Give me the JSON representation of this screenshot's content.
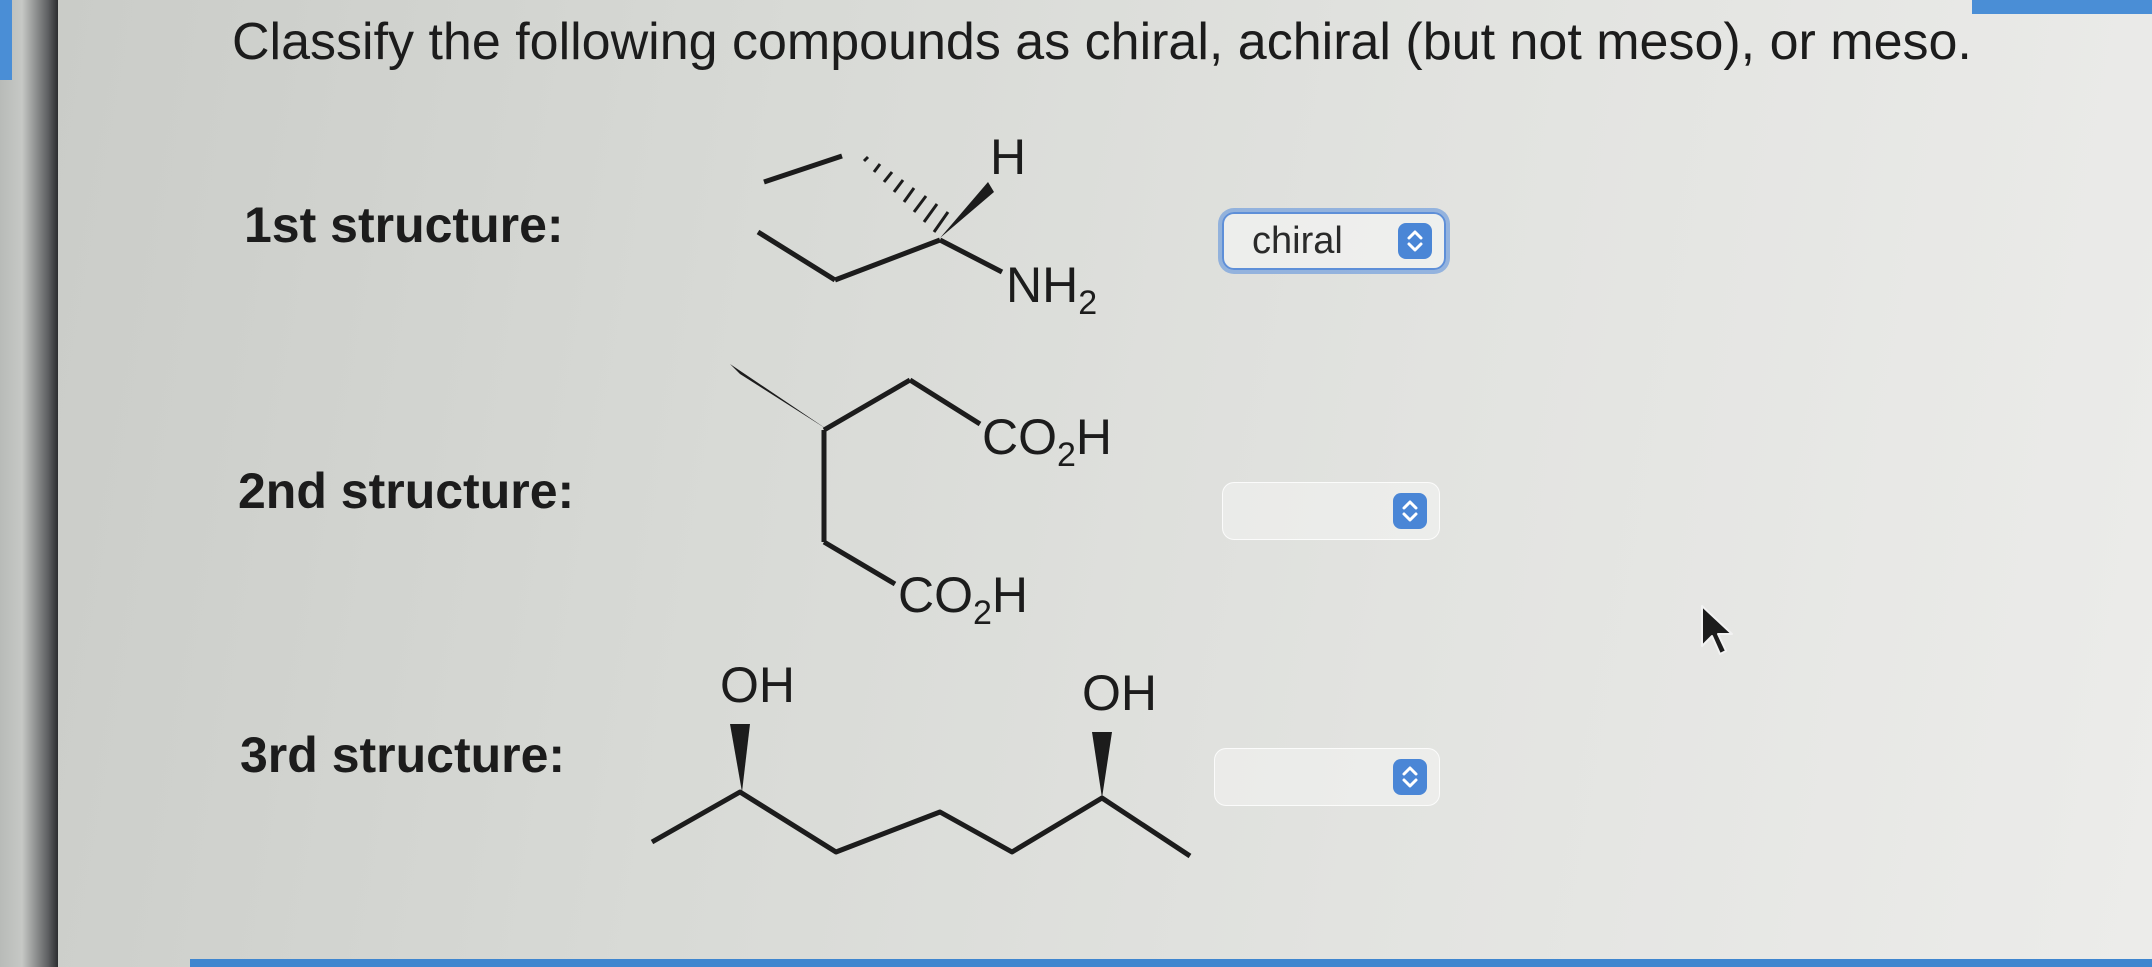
{
  "question": "Classify the following compounds as chiral, achiral (but not meso), or meso.",
  "rows": [
    {
      "label": "1st structure:",
      "selected": "chiral",
      "labels": {
        "top": "H",
        "main": "NH",
        "sub": "2"
      }
    },
    {
      "label": "2nd structure:",
      "selected": "",
      "labels": {
        "a_main": "CO",
        "a_sub": "2",
        "a_end": "H",
        "b_main": "CO",
        "b_sub": "2",
        "b_end": "H"
      }
    },
    {
      "label": "3rd structure:",
      "selected": "",
      "labels": {
        "left": "OH",
        "right": "OH"
      }
    }
  ],
  "icons": {
    "dropdown": "chevron-up-down-icon",
    "cursor": "mouse-pointer-icon"
  },
  "colors": {
    "accent": "#4a86d6",
    "focus_ring": "#5e8fd8",
    "text": "#1c1c1c"
  }
}
